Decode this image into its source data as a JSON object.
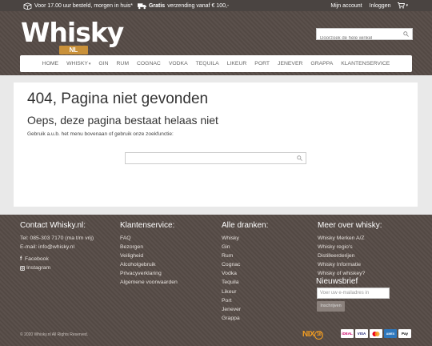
{
  "topbar": {
    "order_text": "Voor 17.00 uur besteld, morgen in huis*",
    "shipping_bold": "Gratis",
    "shipping_text": "verzending vanaf € 100,-",
    "account": "Mijn account",
    "login": "Inloggen"
  },
  "header": {
    "logo_word": "Whisky",
    "logo_suffix": "NL",
    "search_placeholder": "Doorzoek de hele winkel"
  },
  "nav": {
    "items": [
      "Home",
      "Whisky",
      "Gin",
      "Rum",
      "Cognac",
      "Vodka",
      "Tequila",
      "Likeur",
      "Port",
      "Jenever",
      "Grappa",
      "Klantenservice"
    ]
  },
  "main": {
    "title": "404, Pagina niet gevonden",
    "subtitle": "Oeps, deze pagina bestaat helaas niet",
    "hint": "Gebruik a.u.b. het menu bovenaan of gebruik onze zoekfunctie:"
  },
  "footer": {
    "contact": {
      "title": "Contact Whisky.nl:",
      "phone": "Tel: 085-303 7170 (ma t/m vrij)",
      "email": "E-mail: info@whisky.nl",
      "facebook": "Facebook",
      "instagram": "Instagram"
    },
    "service": {
      "title": "Klantenservice:",
      "links": [
        "FAQ",
        "Bezorgen",
        "Veiligheid",
        "Alcoholgebruik",
        "Privacyverklaring",
        "Algemene voorwaarden"
      ]
    },
    "drinks": {
      "title": "Alle dranken:",
      "links": [
        "Whisky",
        "Gin",
        "Rum",
        "Cognac",
        "Vodka",
        "Tequila",
        "Likeur",
        "Port",
        "Jenever",
        "Grappa"
      ]
    },
    "more": {
      "title": "Meer over whisky:",
      "links": [
        "Whisky Merken A/Z",
        "Whisky regio's",
        "Distilleerderijen",
        "Whisky Informatie",
        "Whisky of whiskey?"
      ]
    },
    "newsletter": {
      "title": "Nieuwsbrief",
      "placeholder": "Voer uw e-mailadres in",
      "button": "Inschrijven"
    },
    "copyright": "© 2020 Whisky.nl All Rights Reserved.",
    "nix_text": "NIX",
    "nix_age": "18",
    "payments": [
      "iDEAL",
      "VISA",
      "MC",
      "AMEX",
      "Pay"
    ]
  },
  "colors": {
    "header_bg": "#564b46",
    "topbar_bg": "#4a4441",
    "accent": "#c9913a",
    "nix": "#f29d22"
  }
}
